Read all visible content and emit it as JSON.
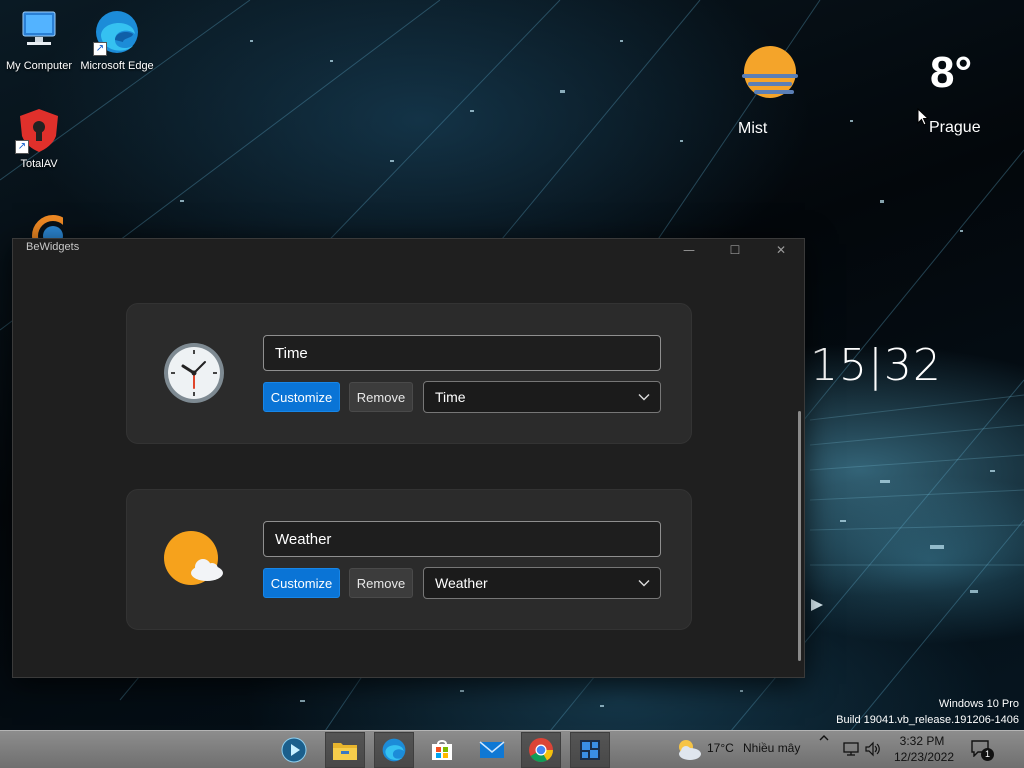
{
  "desktop": {
    "icons": [
      {
        "label": "My Computer"
      },
      {
        "label": "Microsoft Edge"
      },
      {
        "label": "TotalAV"
      }
    ],
    "weather_widget": {
      "condition": "Mist",
      "temperature": "8°",
      "city": "Prague"
    },
    "clock_widget": {
      "hours": "15",
      "separator": "|",
      "minutes": "32"
    },
    "watermark": {
      "edition": "Windows 10 Pro",
      "build": "Build 19041.vb_release.191206-1406"
    }
  },
  "window": {
    "title": "BeWidgets",
    "controls": {
      "minimize": "—",
      "maximize": "☐",
      "close": "✕"
    },
    "widgets": [
      {
        "name_value": "Time",
        "customize_label": "Customize",
        "remove_label": "Remove",
        "type_selected": "Time",
        "icon": "clock-icon"
      },
      {
        "name_value": "Weather",
        "customize_label": "Customize",
        "remove_label": "Remove",
        "type_selected": "Weather",
        "icon": "weather-sun-cloud-icon"
      }
    ]
  },
  "taskbar": {
    "apps": [
      "media-player-icon",
      "file-explorer-icon",
      "edge-icon",
      "store-icon",
      "mail-icon",
      "chrome-icon",
      "bewidgets-icon"
    ],
    "weather": {
      "temperature": "17°C",
      "description": "Nhiều mây"
    },
    "clock": {
      "time": "3:32 PM",
      "date": "12/23/2022"
    },
    "notification_count": "1"
  },
  "colors": {
    "accent": "#0a74d6",
    "window_bg": "#1f1f1f",
    "card_bg": "#2b2b2b",
    "taskbar": "#7d7d7d"
  }
}
